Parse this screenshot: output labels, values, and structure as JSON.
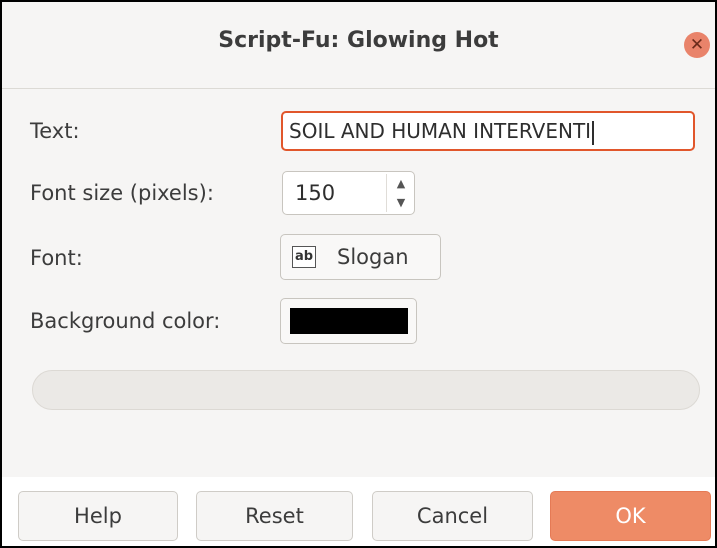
{
  "window": {
    "title": "Script-Fu: Glowing Hot",
    "close_icon": "close-icon",
    "close_glyph": "✕"
  },
  "form": {
    "text_label": "Text:",
    "text_value": "SOIL AND HUMAN INTERVENTI",
    "font_size_label": "Font size (pixels):",
    "font_size_value": "150",
    "spin_up_glyph": "▲",
    "spin_down_glyph": "▼",
    "font_label": "Font:",
    "font_value": "Slogan",
    "font_icon": "font-preview-icon",
    "font_icon_glyph": "ab",
    "bg_color_label": "Background color:",
    "bg_color_value": "#000000"
  },
  "progress": {
    "value": 0
  },
  "buttons": {
    "help": "Help",
    "reset": "Reset",
    "cancel": "Cancel",
    "ok": "OK"
  },
  "colors": {
    "accent": "#ee8b66",
    "focus_border": "#e1562b"
  }
}
